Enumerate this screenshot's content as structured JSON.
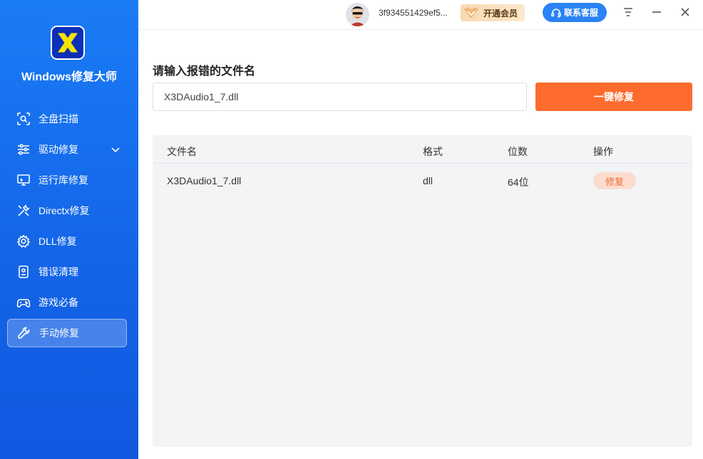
{
  "app": {
    "title": "Windows修复大师"
  },
  "sidebar": {
    "items": [
      {
        "label": "全盘扫描",
        "icon": "scan-icon"
      },
      {
        "label": "驱动修复",
        "icon": "sliders-icon",
        "expandable": true
      },
      {
        "label": "运行库修复",
        "icon": "monitor-icon"
      },
      {
        "label": "Directx修复",
        "icon": "tools-icon"
      },
      {
        "label": "DLL修复",
        "icon": "gear-icon"
      },
      {
        "label": "错误清理",
        "icon": "id-card-icon"
      },
      {
        "label": "游戏必备",
        "icon": "gamepad-icon"
      },
      {
        "label": "手动修复",
        "icon": "wrench-icon",
        "active": true
      }
    ]
  },
  "header": {
    "username": "3f934551429ef5...",
    "vip_label": "开通会员",
    "service_label": "联系客服"
  },
  "main": {
    "heading": "请输入报错的文件名",
    "input_value": "X3DAudio1_7.dll",
    "repair_all_label": "一键修复",
    "table": {
      "columns": [
        "文件名",
        "格式",
        "位数",
        "操作"
      ],
      "rows": [
        {
          "filename": "X3DAudio1_7.dll",
          "format": "dll",
          "bits": "64位",
          "action": "修复"
        }
      ]
    }
  },
  "colors": {
    "sidebar": "#1a7cf5",
    "accent_orange": "#fd6b2d",
    "service_blue": "#2a83f5",
    "table_bg": "#f2f4f5"
  }
}
